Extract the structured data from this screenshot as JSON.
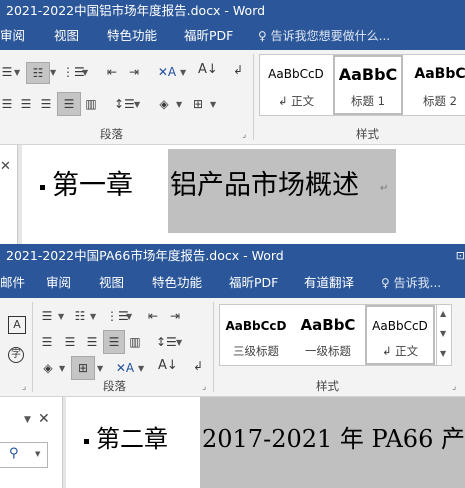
{
  "window1": {
    "title": "2021-2022中国铝市场年度报告.docx - Word",
    "tabs": [
      "审阅",
      "视图",
      "特色功能",
      "福昕PDF"
    ],
    "tell_me": "告诉我您想要做什么...",
    "group_paragraph": "段落",
    "group_styles": "样式",
    "styles": [
      {
        "preview": "AaBbCcD",
        "name": "正文"
      },
      {
        "preview": "AaBbC",
        "name": "标题 1"
      },
      {
        "preview": "AaBbC",
        "name": "标题 2"
      }
    ],
    "heading_prefix": "第一章",
    "heading_title": "铝产品市场概述",
    "return_mark": "↵"
  },
  "window2": {
    "title": "2021-2022中国PA66市场年度报告.docx - Word",
    "tabs": [
      "邮件",
      "审阅",
      "视图",
      "特色功能",
      "福昕PDF",
      "有道翻译"
    ],
    "tell_me": "告诉我...",
    "group_paragraph": "段落",
    "group_styles": "样式",
    "styles": [
      {
        "preview": "AaBbCcD",
        "name": "三级标题"
      },
      {
        "preview": "AaBbC",
        "name": "一级标题"
      },
      {
        "preview": "AaBbCcD",
        "name": "正文"
      }
    ],
    "heading_prefix": "第二章",
    "heading_title": "2017-2021 年 PA66 产",
    "return_mark": "↵"
  }
}
